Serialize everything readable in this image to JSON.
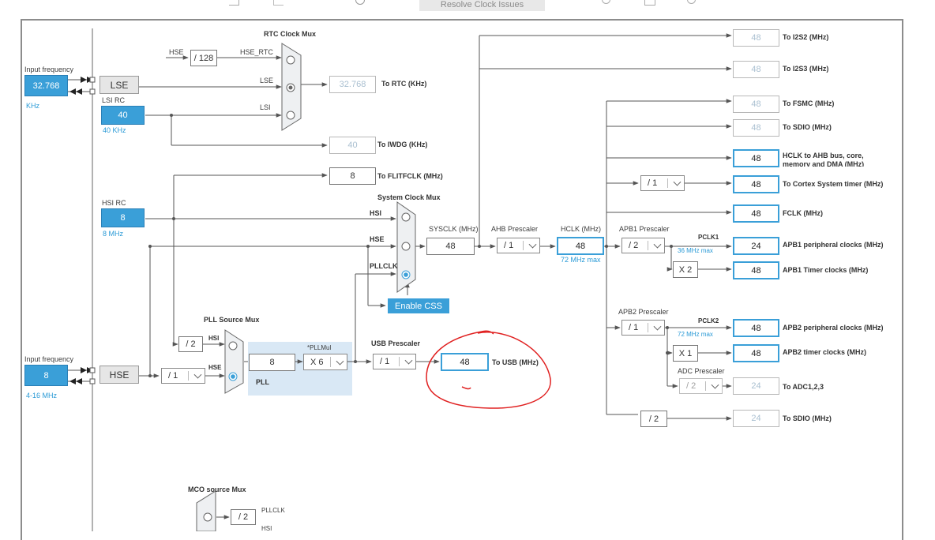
{
  "toolbar": {
    "resolve_label": "Resolve Clock Issues"
  },
  "inputs": {
    "lse_input": {
      "title": "Input frequency",
      "value": "32.768",
      "unit": "KHz"
    },
    "hse_input": {
      "title": "Input frequency",
      "value": "8",
      "unit": "4-16 MHz"
    }
  },
  "sources": {
    "lse": "LSE",
    "hse": "HSE",
    "lsi_rc": {
      "title": "LSI RC",
      "value": "40",
      "note": "40 KHz"
    },
    "hsi_rc": {
      "title": "HSI RC",
      "value": "8",
      "note": "8 MHz"
    }
  },
  "rtc": {
    "mux_title": "RTC Clock Mux",
    "hse_label": "HSE",
    "div_value": "/ 128",
    "hse_rtc_label": "HSE_RTC",
    "lse_label": "LSE",
    "lsi_label": "LSI",
    "output_value": "32.768",
    "output_label": "To RTC (KHz)"
  },
  "iwdg": {
    "value": "40",
    "label": "To IWDG (KHz)"
  },
  "flitf": {
    "value": "8",
    "label": "To FLITFCLK (MHz)"
  },
  "sysmux": {
    "title": "System Clock Mux",
    "hsi": "HSI",
    "hse": "HSE",
    "pllclk": "PLLCLK",
    "enable_css": "Enable CSS"
  },
  "sysclk": {
    "label": "SYSCLK (MHz)",
    "value": "48"
  },
  "ahb": {
    "label": "AHB Prescaler",
    "value": "/ 1"
  },
  "hclk": {
    "label": "HCLK (MHz)",
    "value": "48",
    "note": "72 MHz max"
  },
  "apb1": {
    "label": "APB1 Prescaler",
    "value": "/ 2",
    "pclk_label": "PCLK1",
    "pclk_note": "36 MHz max",
    "timer_mult": "X 2"
  },
  "apb2": {
    "label": "APB2 Prescaler",
    "value": "/ 1",
    "pclk_label": "PCLK2",
    "pclk_note": "72 MHz max",
    "timer_mult": "X 1"
  },
  "adc": {
    "label": "ADC Prescaler",
    "value": "/ 2"
  },
  "cortex_div": "/ 1",
  "sdio_div": "/ 2",
  "outputs": [
    {
      "value": "48",
      "label": "To I2S2 (MHz)"
    },
    {
      "value": "48",
      "label": "To I2S3 (MHz)"
    },
    {
      "value": "48",
      "label": "To FSMC (MHz)"
    },
    {
      "value": "48",
      "label": "To SDIO (MHz)"
    },
    {
      "value": "48",
      "label": "HCLK to AHB bus, core, memory and DMA (MHz)"
    },
    {
      "value": "48",
      "label": "To Cortex System timer (MHz)"
    },
    {
      "value": "48",
      "label": "FCLK (MHz)"
    },
    {
      "value": "24",
      "label": "APB1 peripheral clocks (MHz)"
    },
    {
      "value": "48",
      "label": "APB1 Timer clocks (MHz)"
    },
    {
      "value": "48",
      "label": "APB2 peripheral clocks (MHz)"
    },
    {
      "value": "48",
      "label": "APB2 timer clocks (MHz)"
    },
    {
      "value": "24",
      "label": "To ADC1,2,3"
    },
    {
      "value": "24",
      "label": "To SDIO (MHz)"
    }
  ],
  "pll": {
    "mux_title": "PLL Source Mux",
    "hsi_div": "/ 2",
    "hsi_label": "HSI",
    "hse_label": "HSE",
    "hse_div": "/ 1",
    "value": "8",
    "mul_label": "*PLLMul",
    "mul_value": "X 6",
    "pll_label": "PLL"
  },
  "usb": {
    "prescaler_label": "USB Prescaler",
    "prescaler_value": "/ 1",
    "value": "48",
    "label": "To USB (MHz)"
  },
  "mco": {
    "title": "MCO source Mux",
    "div": "/ 2",
    "pllclk": "PLLCLK",
    "hsi": "HSI"
  },
  "colors": {
    "accent": "#3a9fd8",
    "annotation": "#e02020",
    "wire": "#555555"
  }
}
